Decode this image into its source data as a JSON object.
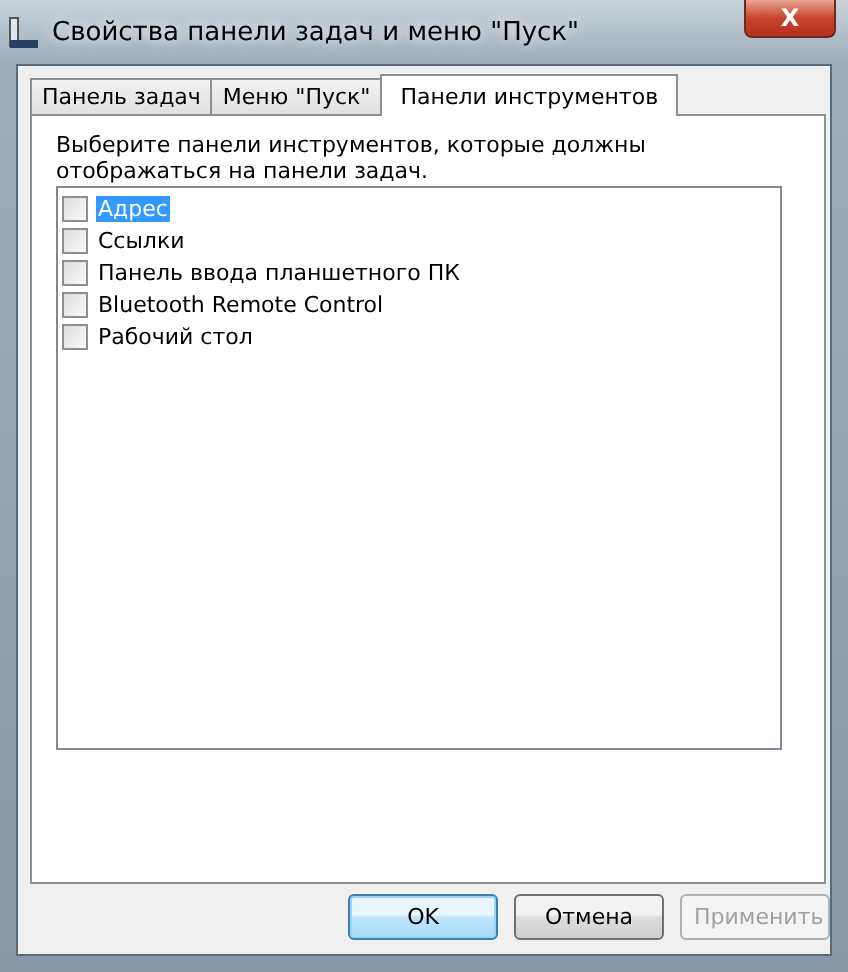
{
  "window": {
    "title": "Свойства панели задач и меню \"Пуск\"",
    "close": "X"
  },
  "tabs": [
    {
      "label": "Панель задач",
      "selected": false
    },
    {
      "label": "Меню \"Пуск\"",
      "selected": false
    },
    {
      "label": "Панели инструментов",
      "selected": true
    }
  ],
  "instruction": "Выберите панели инструментов, которые должны отображаться на панели задач.",
  "toolbars": [
    {
      "label": "Адрес",
      "checked": false,
      "selected": true
    },
    {
      "label": "Ссылки",
      "checked": false,
      "selected": false
    },
    {
      "label": "Панель ввода планшетного ПК",
      "checked": false,
      "selected": false
    },
    {
      "label": "Bluetooth Remote Control",
      "checked": false,
      "selected": false
    },
    {
      "label": "Рабочий стол",
      "checked": false,
      "selected": false
    }
  ],
  "buttons": [
    {
      "label": "OK",
      "kind": "default",
      "disabled": false
    },
    {
      "label": "Отмена",
      "kind": "normal",
      "disabled": false
    },
    {
      "label": "Применить",
      "kind": "normal",
      "disabled": true
    }
  ]
}
